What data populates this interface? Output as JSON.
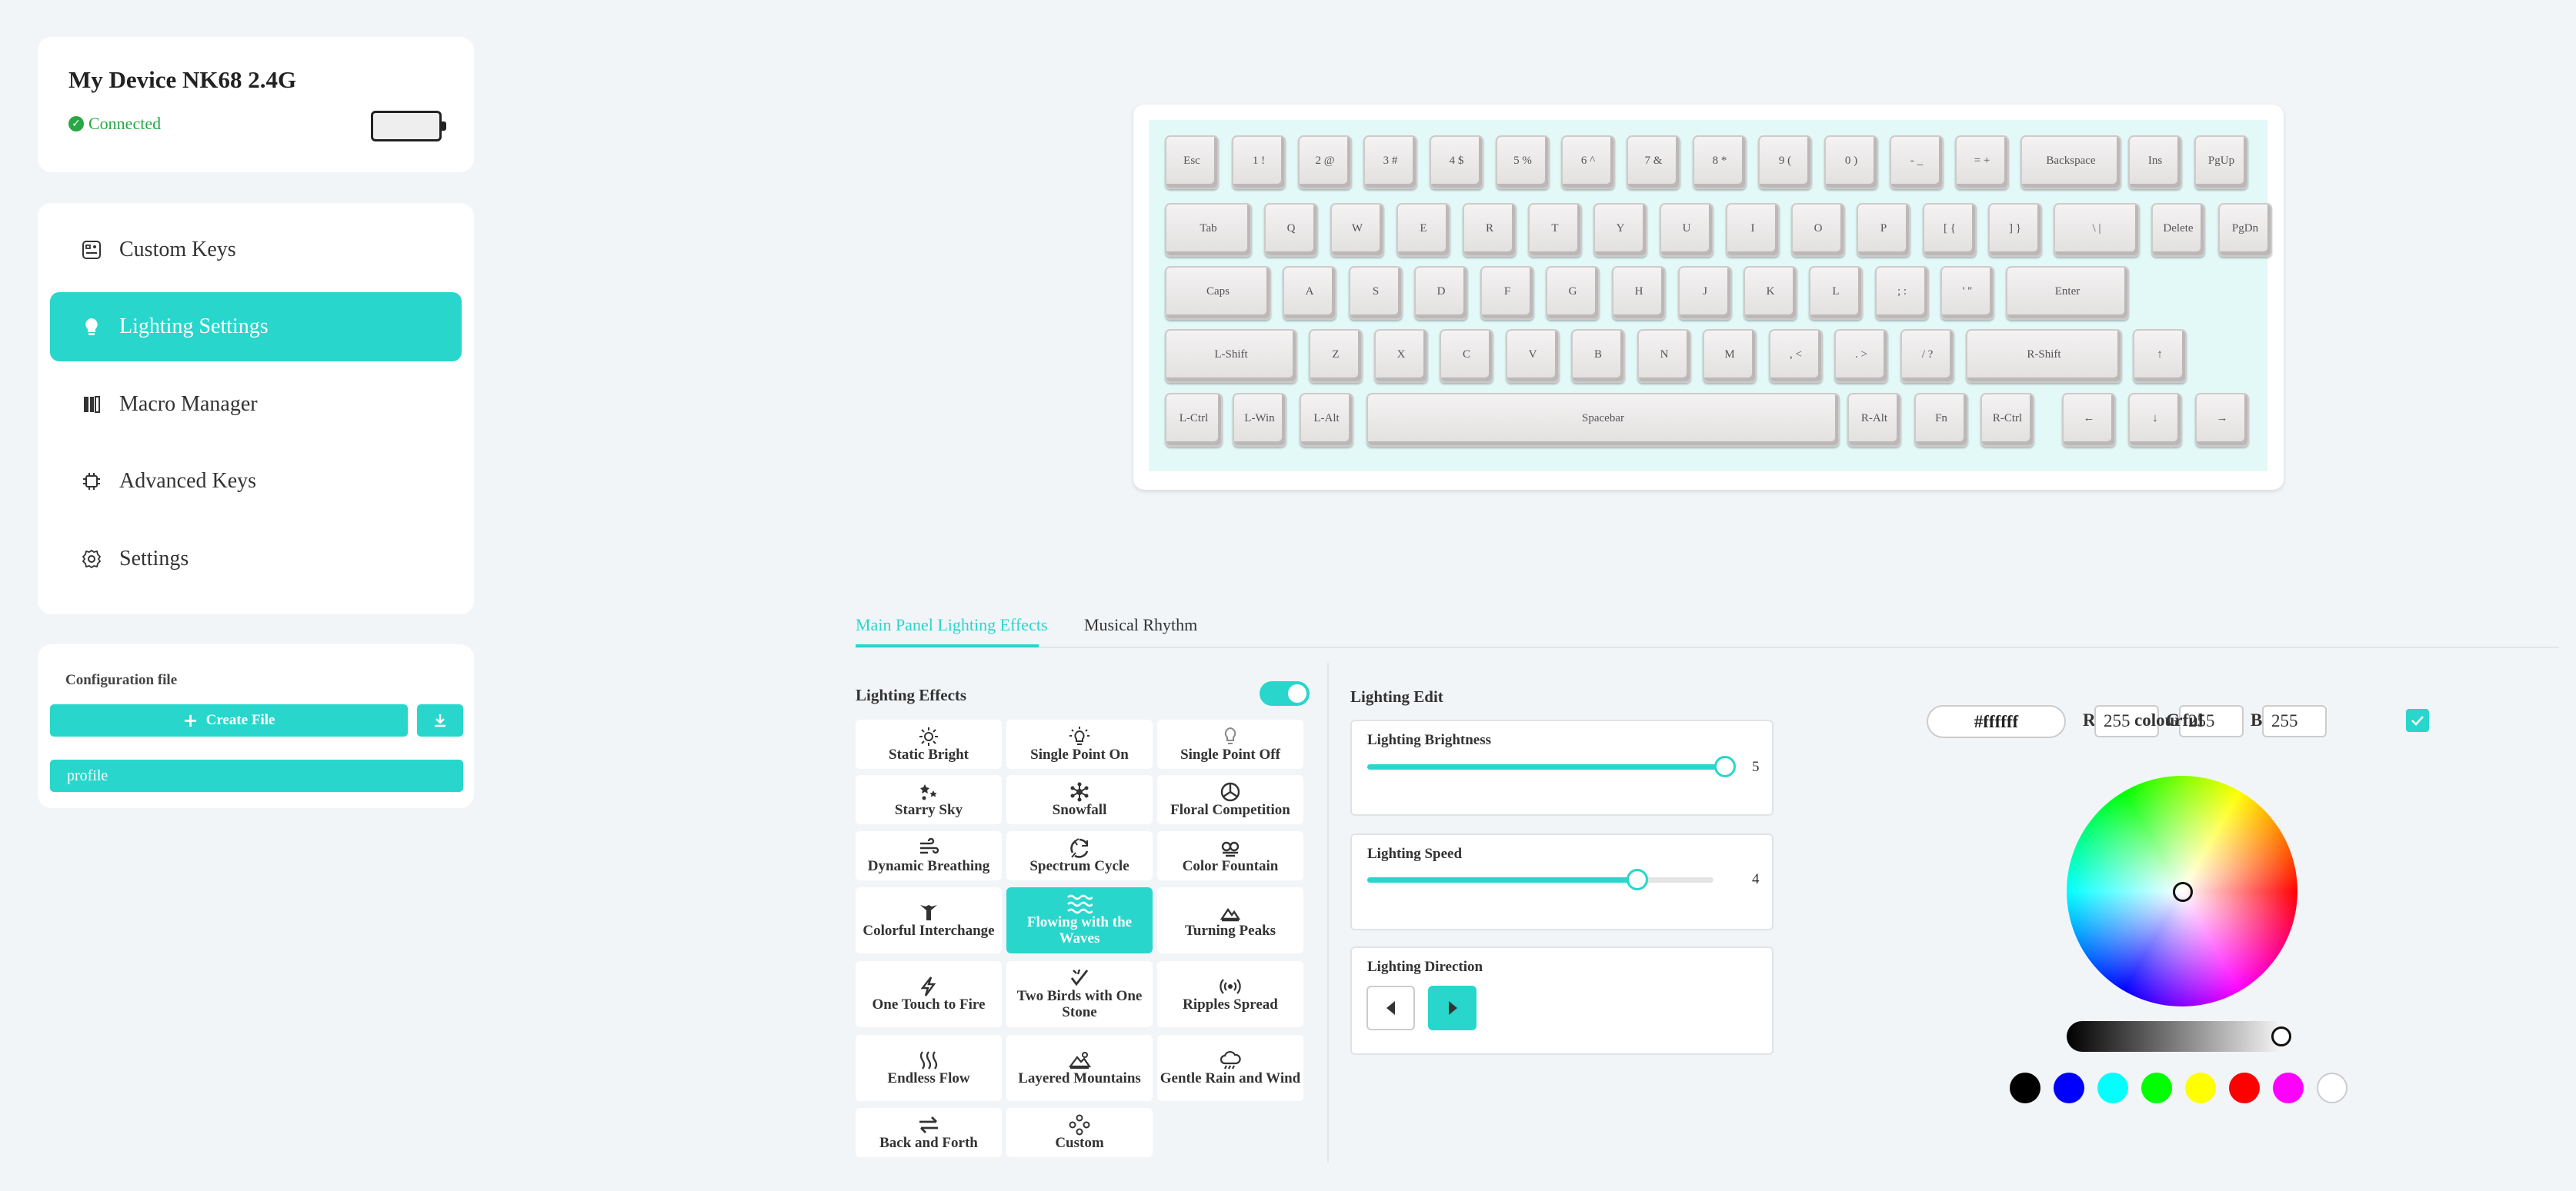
{
  "device": {
    "name": "My Device NK68 2.4G",
    "status": "Connected"
  },
  "nav": {
    "items": [
      {
        "label": "Custom Keys",
        "icon": "custom-keys-icon"
      },
      {
        "label": "Lighting Settings",
        "icon": "lightbulb-icon",
        "active": true
      },
      {
        "label": "Macro Manager",
        "icon": "macro-icon"
      },
      {
        "label": "Advanced Keys",
        "icon": "chip-icon"
      },
      {
        "label": "Settings",
        "icon": "gear-icon"
      }
    ]
  },
  "config": {
    "title": "Configuration file",
    "create_label": "Create File",
    "profile": "profile"
  },
  "keyboard": {
    "keys": [
      "Esc",
      "1 !",
      "2 @",
      "3 #",
      "4 $",
      "5 %",
      "6 ^",
      "7 &",
      "8 *",
      "9 (",
      "0 )",
      "- _",
      "= +",
      "Backspace",
      "Ins",
      "PgUp",
      "Tab",
      "Q",
      "W",
      "E",
      "R",
      "T",
      "Y",
      "U",
      "I",
      "O",
      "P",
      "[ {",
      "] }",
      "\\ |",
      "Delete",
      "PgDn",
      "Caps",
      "A",
      "S",
      "D",
      "F",
      "G",
      "H",
      "J",
      "K",
      "L",
      "; :",
      "' \"",
      "Enter",
      "L-Shift",
      "Z",
      "X",
      "C",
      "V",
      "B",
      "N",
      "M",
      ", <",
      ". >",
      "/ ?",
      "R-Shift",
      "↑",
      "L-Ctrl",
      "L-Win",
      "L-Alt",
      "Spacebar",
      "R-Alt",
      "Fn",
      "R-Ctrl",
      "←",
      "↓",
      "→"
    ]
  },
  "tabs": [
    {
      "label": "Main Panel Lighting Effects",
      "active": true
    },
    {
      "label": "Musical Rhythm"
    }
  ],
  "effects": {
    "title": "Lighting Effects",
    "enabled": true,
    "items": [
      {
        "label": "Static Bright",
        "icon": "sun-icon"
      },
      {
        "label": "Single Point On",
        "icon": "bulb-on-icon"
      },
      {
        "label": "Single Point Off",
        "icon": "bulb-off-icon"
      },
      {
        "label": "Starry Sky",
        "icon": "stars-icon"
      },
      {
        "label": "Snowfall",
        "icon": "snowflake-icon"
      },
      {
        "label": "Floral Competition",
        "icon": "flower-icon"
      },
      {
        "label": "Dynamic Breathing",
        "icon": "wind-icon"
      },
      {
        "label": "Spectrum Cycle",
        "icon": "cycle-icon"
      },
      {
        "label": "Color Fountain",
        "icon": "fountain-icon"
      },
      {
        "label": "Colorful Interchange",
        "icon": "interchange-icon"
      },
      {
        "label": "Flowing with the Waves",
        "icon": "waves-icon",
        "active": true
      },
      {
        "label": "Turning Peaks",
        "icon": "peaks-icon"
      },
      {
        "label": "One Touch to Fire",
        "icon": "bolt-icon"
      },
      {
        "label": "Two Birds with One Stone",
        "icon": "birds-icon"
      },
      {
        "label": "Ripples Spread",
        "icon": "ripples-icon"
      },
      {
        "label": "Endless Flow",
        "icon": "flow-icon"
      },
      {
        "label": "Layered Mountains",
        "icon": "mountains-icon"
      },
      {
        "label": "Gentle Rain and Wind",
        "icon": "rain-icon"
      },
      {
        "label": "Back and Forth",
        "icon": "arrows-icon"
      },
      {
        "label": "Custom",
        "icon": "custom-icon"
      }
    ]
  },
  "edit": {
    "title": "Lighting Edit",
    "brightness": {
      "label": "Lighting Brightness",
      "value": "5",
      "fraction": 1.0
    },
    "speed": {
      "label": "Lighting Speed",
      "value": "4",
      "fraction": 0.78
    },
    "direction": {
      "label": "Lighting Direction",
      "selected": "right"
    }
  },
  "color": {
    "hex": "#ffffff",
    "r_label": "R",
    "g_label": "G",
    "b_label": "B",
    "r": "255",
    "g": "255",
    "b": "255",
    "colourful_label": "colourful",
    "colourful": true,
    "swatches": [
      "#000000",
      "#0000ff",
      "#00ffff",
      "#00ff00",
      "#ffff00",
      "#ff0000",
      "#ff00ff",
      "#ffffff"
    ],
    "accent": "#28d6cc"
  }
}
